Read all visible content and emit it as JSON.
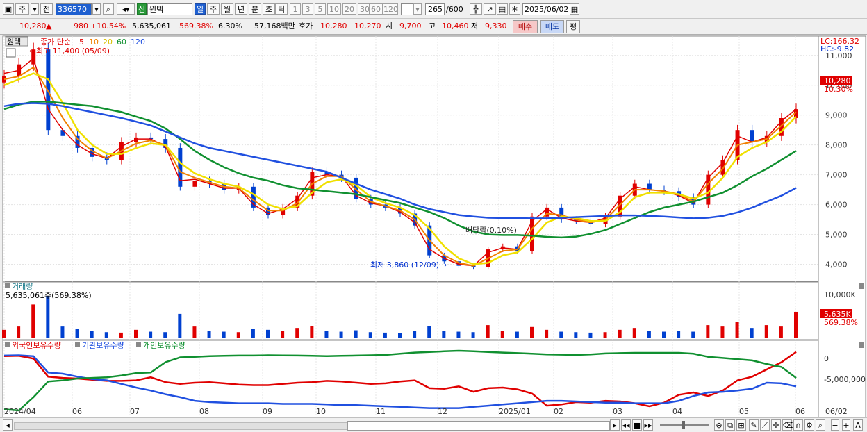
{
  "toolbar": {
    "period_main": "주",
    "prev_label": "전",
    "code": "336570",
    "name": "원텍",
    "name_tag": "신",
    "periods": [
      "일",
      "주",
      "월",
      "년",
      "분",
      "초",
      "틱"
    ],
    "minutes": [
      "1",
      "3",
      "5",
      "10",
      "20",
      "30",
      "60",
      "120"
    ],
    "count": "265",
    "count_total": "/600",
    "date": "2025/06/02"
  },
  "info": {
    "price": "10,280",
    "change_arrow": "▲",
    "change": "980",
    "change_pct": "+10.54%",
    "volume": "5,635,061",
    "volume_pct": "569.38%",
    "turnover": "6.30%",
    "amount": "57,168백만",
    "quote_label": "호가",
    "quote_bid": "10,280",
    "quote_ask": "10,270",
    "open_label": "시",
    "open": "9,700",
    "high_label": "고",
    "high": "10,460",
    "low_label": "저",
    "low": "9,330",
    "buy": "매수",
    "sell": "매도",
    "eval": "평"
  },
  "price_panel": {
    "name_tab": "원텍",
    "ma_legend": "종가 단순",
    "ma_periods": [
      "5",
      "10",
      "20",
      "60",
      "120"
    ],
    "high_note": "최고 11,400 (05/09)",
    "low_note": "최저 3,860 (12/09)",
    "dividend_note": "배당락(0.10%)",
    "lc": "LC:166.32",
    "hc": "HC:-9.82",
    "last_price_box": "10,280",
    "last_pct": "10.30%",
    "y_ticks": [
      "11,000",
      "10,000",
      "9,000",
      "8,000",
      "7,000",
      "6,000",
      "5,000",
      "4,000"
    ]
  },
  "volume_panel": {
    "title": "거래량",
    "value": "5,635,061주(569.38%)",
    "y_tick": "10,000K",
    "last_box": "5,635K",
    "last_pct": "569.38%"
  },
  "holding_panel": {
    "legend": [
      "외국인보유수량",
      "기관보유수량",
      "개인보유수량"
    ],
    "y_ticks": [
      "0",
      "-5,000,000"
    ]
  },
  "x_axis": [
    "2024/04",
    "06",
    "07",
    "08",
    "09",
    "10",
    "11",
    "12",
    "2025/01",
    "02",
    "03",
    "04",
    "05",
    "06",
    "06/02"
  ],
  "colors": {
    "up": "#e00000",
    "down": "#0040d0",
    "ma5": "#e00000",
    "ma10": "#f08000",
    "ma20": "#f0e000",
    "ma60": "#109030",
    "ma120": "#2050e0",
    "foreign": "#e00000",
    "institution": "#2050e0",
    "individual": "#109030"
  },
  "chart_data": {
    "type": "line",
    "title": "원텍 (336570)",
    "xlabel": "",
    "ylabel": "",
    "ylim": [
      3500,
      11600
    ],
    "x": [
      "2024/04",
      "2024/04",
      "2024/05",
      "2024/05",
      "2024/05",
      "2024/05",
      "2024/06",
      "2024/06",
      "2024/06",
      "2024/06",
      "2024/07",
      "2024/07",
      "2024/07",
      "2024/07",
      "2024/08",
      "2024/08",
      "2024/08",
      "2024/08",
      "2024/09",
      "2024/09",
      "2024/09",
      "2024/09",
      "2024/10",
      "2024/10",
      "2024/10",
      "2024/10",
      "2024/11",
      "2024/11",
      "2024/11",
      "2024/11",
      "2024/12",
      "2024/12",
      "2024/12",
      "2024/12",
      "2025/01",
      "2025/01",
      "2025/01",
      "2025/01",
      "2025/02",
      "2025/02",
      "2025/02",
      "2025/02",
      "2025/03",
      "2025/03",
      "2025/03",
      "2025/03",
      "2025/04",
      "2025/04",
      "2025/04",
      "2025/04",
      "2025/05",
      "2025/05",
      "2025/05",
      "2025/05",
      "2025/06"
    ],
    "series": [
      {
        "name": "종가",
        "values": [
          10300,
          10700,
          11200,
          8500,
          8300,
          7900,
          7600,
          7500,
          8100,
          8250,
          8200,
          7900,
          6600,
          6800,
          6700,
          6500,
          6600,
          5900,
          5650,
          5900,
          6300,
          7100,
          7000,
          6900,
          6200,
          6000,
          5900,
          5700,
          5300,
          4300,
          4100,
          3950,
          3900,
          4500,
          4600,
          4450,
          5600,
          5900,
          5500,
          5450,
          5350,
          5600,
          6300,
          6700,
          6500,
          6450,
          6250,
          6000,
          7000,
          7500,
          8500,
          8100,
          8300,
          8900,
          9200
        ]
      },
      {
        "name": "5",
        "values": [
          10400,
          10500,
          10900,
          9200,
          8500,
          8000,
          7700,
          7550,
          7950,
          8200,
          8200,
          7950,
          6800,
          6850,
          6700,
          6550,
          6550,
          6000,
          5700,
          5850,
          6200,
          6900,
          7000,
          6950,
          6300,
          6050,
          5950,
          5750,
          5400,
          4500,
          4200,
          4000,
          3950,
          4400,
          4550,
          4500,
          5450,
          5850,
          5550,
          5450,
          5400,
          5550,
          6200,
          6600,
          6500,
          6450,
          6300,
          6050,
          6900,
          7400,
          8300,
          8100,
          8250,
          8800,
          9200
        ]
      },
      {
        "name": "10",
        "values": [
          10200,
          10300,
          10600,
          9800,
          8900,
          8200,
          7800,
          7550,
          7800,
          8050,
          8150,
          8000,
          7100,
          6900,
          6750,
          6600,
          6550,
          6150,
          5800,
          5800,
          6050,
          6700,
          6950,
          6950,
          6500,
          6100,
          5950,
          5800,
          5500,
          4800,
          4300,
          4050,
          3950,
          4200,
          4450,
          4500,
          5200,
          5700,
          5650,
          5500,
          5400,
          5500,
          6000,
          6500,
          6500,
          6450,
          6350,
          6100,
          6700,
          7200,
          8000,
          8100,
          8200,
          8650,
          9100
        ]
      },
      {
        "name": "20",
        "values": [
          10000,
          10200,
          10400,
          10200,
          9400,
          8500,
          8000,
          7700,
          7700,
          7900,
          8050,
          8000,
          7400,
          7050,
          6850,
          6700,
          6600,
          6350,
          6000,
          5850,
          5950,
          6400,
          6750,
          6850,
          6650,
          6250,
          6050,
          5900,
          5650,
          5200,
          4600,
          4200,
          4000,
          4050,
          4300,
          4400,
          4850,
          5400,
          5600,
          5550,
          5450,
          5450,
          5750,
          6250,
          6400,
          6400,
          6350,
          6200,
          6400,
          6900,
          7600,
          7900,
          8100,
          8450,
          8950
        ]
      },
      {
        "name": "60",
        "values": [
          9200,
          9350,
          9450,
          9450,
          9400,
          9350,
          9300,
          9200,
          9100,
          8950,
          8800,
          8550,
          8200,
          7800,
          7500,
          7250,
          7050,
          6900,
          6800,
          6650,
          6550,
          6500,
          6450,
          6400,
          6350,
          6250,
          6150,
          6050,
          5900,
          5750,
          5550,
          5300,
          5100,
          5000,
          4980,
          4980,
          4960,
          4920,
          4900,
          4930,
          5020,
          5150,
          5350,
          5550,
          5750,
          5900,
          6000,
          6100,
          6250,
          6400,
          6650,
          6950,
          7200,
          7500,
          7800
        ]
      },
      {
        "name": "120",
        "values": [
          9300,
          9380,
          9400,
          9380,
          9300,
          9200,
          9100,
          9000,
          8900,
          8780,
          8650,
          8450,
          8250,
          8050,
          7900,
          7800,
          7700,
          7600,
          7500,
          7400,
          7300,
          7200,
          7100,
          6900,
          6700,
          6500,
          6350,
          6200,
          6000,
          5850,
          5750,
          5650,
          5600,
          5560,
          5550,
          5550,
          5540,
          5540,
          5560,
          5580,
          5600,
          5620,
          5640,
          5640,
          5620,
          5600,
          5570,
          5540,
          5560,
          5620,
          5740,
          5900,
          6100,
          6300,
          6560
        ]
      }
    ],
    "volume_series": [
      1800,
      2500,
      7200,
      9000,
      2500,
      2000,
      1500,
      1300,
      1200,
      1800,
      1400,
      1300,
      5200,
      2500,
      1500,
      1400,
      1300,
      2000,
      1800,
      1500,
      2200,
      2600,
      1600,
      1400,
      1700,
      1300,
      1200,
      1100,
      1500,
      2600,
      1600,
      1400,
      1300,
      2800,
      1600,
      1400,
      2400,
      1800,
      1400,
      1300,
      1200,
      1300,
      1800,
      2200,
      1600,
      1400,
      1500,
      1400,
      2800,
      2500,
      3500,
      2200,
      2800,
      2500,
      5635
    ],
    "holding_series": [
      {
        "name": "외국인보유수량",
        "values": [
          -200000,
          -150000,
          -600000,
          -3600000,
          -3800000,
          -3900000,
          -4100000,
          -4300000,
          -4300000,
          -4200000,
          -3700000,
          -4500000,
          -4800000,
          -4600000,
          -4500000,
          -4700000,
          -4900000,
          -5000000,
          -5000000,
          -4800000,
          -4600000,
          -4500000,
          -4300000,
          -4400000,
          -4600000,
          -4800000,
          -4700000,
          -4400000,
          -4200000,
          -5500000,
          -5600000,
          -5200000,
          -6100000,
          -5500000,
          -5400000,
          -5700000,
          -6400000,
          -8400000,
          -8200000,
          -7800000,
          -7900000,
          -7600000,
          -7700000,
          -8000000,
          -8500000,
          -7900000,
          -6600000,
          -6200000,
          -6800000,
          -5900000,
          -4200000,
          -3600000,
          -2400000,
          -1200000,
          500000
        ]
      },
      {
        "name": "기관보유수량",
        "values": [
          -100000,
          -50000,
          -200000,
          -2900000,
          -3100000,
          -3600000,
          -4000000,
          -4200000,
          -4800000,
          -5400000,
          -5900000,
          -6500000,
          -7000000,
          -7600000,
          -7800000,
          -7900000,
          -8000000,
          -8000000,
          -8000000,
          -8100000,
          -8100000,
          -8100000,
          -8200000,
          -8300000,
          -8300000,
          -8400000,
          -8500000,
          -8600000,
          -8700000,
          -8800000,
          -8800000,
          -8800000,
          -8600000,
          -8400000,
          -8200000,
          -8000000,
          -7800000,
          -7600000,
          -7600000,
          -7700000,
          -7800000,
          -7900000,
          -7900000,
          -8000000,
          -8000000,
          -8000000,
          -7600000,
          -6800000,
          -6200000,
          -6100000,
          -5900000,
          -5600000,
          -4600000,
          -4700000,
          -5200000
        ]
      },
      {
        "name": "개인보유수량",
        "values": [
          -9000000,
          -9200000,
          -7000000,
          -4400000,
          -4200000,
          -3900000,
          -3800000,
          -3700000,
          -3400000,
          -3000000,
          -2900000,
          -1200000,
          -400000,
          -300000,
          -200000,
          -150000,
          -100000,
          -100000,
          -50000,
          -80000,
          -100000,
          -150000,
          -200000,
          -150000,
          -100000,
          -50000,
          0,
          200000,
          400000,
          500000,
          600000,
          700000,
          600000,
          500000,
          400000,
          300000,
          200000,
          100000,
          50000,
          0,
          100000,
          250000,
          300000,
          350000,
          350000,
          350000,
          350000,
          200000,
          -300000,
          -500000,
          -700000,
          -900000,
          -1500000,
          -2000000,
          -3800000
        ]
      }
    ]
  }
}
